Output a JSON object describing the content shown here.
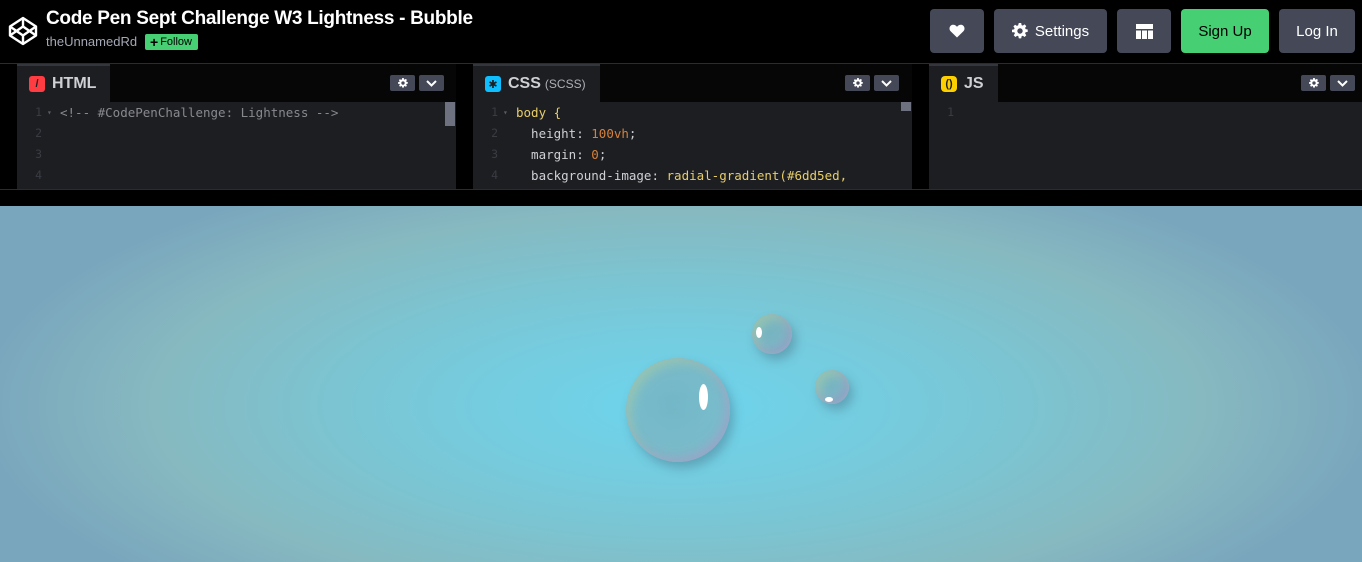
{
  "header": {
    "title": "Code Pen Sept Challenge W3 Lightness - Bubble",
    "author": "theUnnamedRd",
    "follow_label": "Follow",
    "buttons": {
      "settings_label": "Settings",
      "signup_label": "Sign Up",
      "login_label": "Log In"
    }
  },
  "editors": {
    "html": {
      "label": "HTML",
      "icon": "html-slash-icon",
      "lines": [
        {
          "n": "1",
          "fold": "▾",
          "text": "<!-- #CodePenChallenge: Lightness -->"
        },
        {
          "n": "2",
          "fold": "",
          "text": ""
        },
        {
          "n": "3",
          "fold": "",
          "text": ""
        },
        {
          "n": "4",
          "fold": "",
          "text": ""
        }
      ]
    },
    "css": {
      "label": "CSS",
      "sublabel": "(SCSS)",
      "icon": "css-asterisk-icon",
      "lines": [
        {
          "n": "1",
          "fold": "▾",
          "sel": "body",
          "brace": " {"
        },
        {
          "n": "2",
          "fold": "",
          "prop": "  height",
          "colon": ": ",
          "val": "100vh",
          "end": ";"
        },
        {
          "n": "3",
          "fold": "",
          "prop": "  margin",
          "colon": ": ",
          "val": "0",
          "end": ";"
        },
        {
          "n": "4",
          "fold": "",
          "prop": "  background-image",
          "colon": ": ",
          "fn": "radial-gradient",
          "args": "(#6dd5ed,"
        }
      ]
    },
    "js": {
      "label": "JS",
      "icon": "js-braces-icon",
      "lines": [
        {
          "n": "1",
          "fold": "",
          "text": ""
        }
      ]
    }
  },
  "colors": {
    "signup": "#47cf73",
    "button_bg": "#444857",
    "html_icon": "#ff3c41",
    "css_icon": "#0ebeff",
    "js_icon": "#fcd000",
    "preview_center": "#6dd5ed"
  },
  "icons": {
    "logo": "codepen-cube-logo",
    "heart": "heart-icon",
    "settings": "gear-icon",
    "layout": "layout-grid-icon",
    "editor_settings": "gear-icon",
    "editor_collapse": "chevron-down-icon"
  }
}
